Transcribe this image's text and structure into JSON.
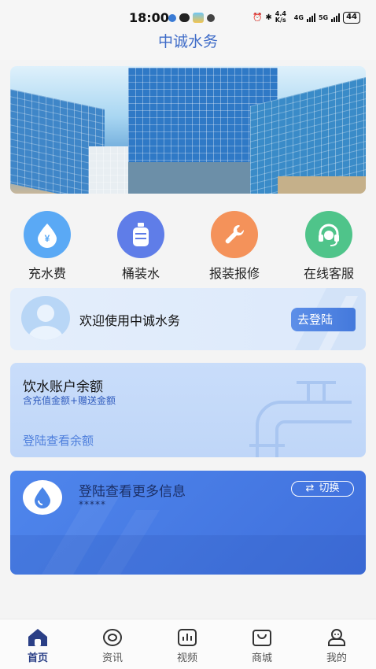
{
  "status_bar": {
    "time": "18:00",
    "network_speed": "4.4 K/s",
    "signal_1": "4G",
    "signal_2": "5G",
    "battery": "44"
  },
  "app": {
    "title": "中诚水务"
  },
  "quick_actions": [
    {
      "label": "充水费",
      "icon": "yuan-drop-icon",
      "color": "#5aa9f5"
    },
    {
      "label": "桶装水",
      "icon": "water-bucket-icon",
      "color": "#5f7de8"
    },
    {
      "label": "报装报修",
      "icon": "wrench-icon",
      "color": "#f4925a"
    },
    {
      "label": "在线客服",
      "icon": "headset-icon",
      "color": "#4fc48a"
    }
  ],
  "welcome": {
    "text": "欢迎使用中诚水务",
    "login_button": "去登陆"
  },
  "balance": {
    "title": "饮水账户余额",
    "subtitle": "含充值金额+赠送金额",
    "link": "登陆查看余额"
  },
  "info_card": {
    "title": "登陆查看更多信息",
    "masked": "*****",
    "switch_label": "切换"
  },
  "tabbar": [
    {
      "label": "首页",
      "icon": "home-icon",
      "active": true
    },
    {
      "label": "资讯",
      "icon": "news-icon",
      "active": false
    },
    {
      "label": "视频",
      "icon": "video-icon",
      "active": false
    },
    {
      "label": "商城",
      "icon": "shop-bag-icon",
      "active": false
    },
    {
      "label": "我的",
      "icon": "profile-icon",
      "active": false
    }
  ],
  "colors": {
    "brand": "#3f6cc8",
    "accent_blue": "#4479dc",
    "tab_active": "#2a3f86"
  }
}
